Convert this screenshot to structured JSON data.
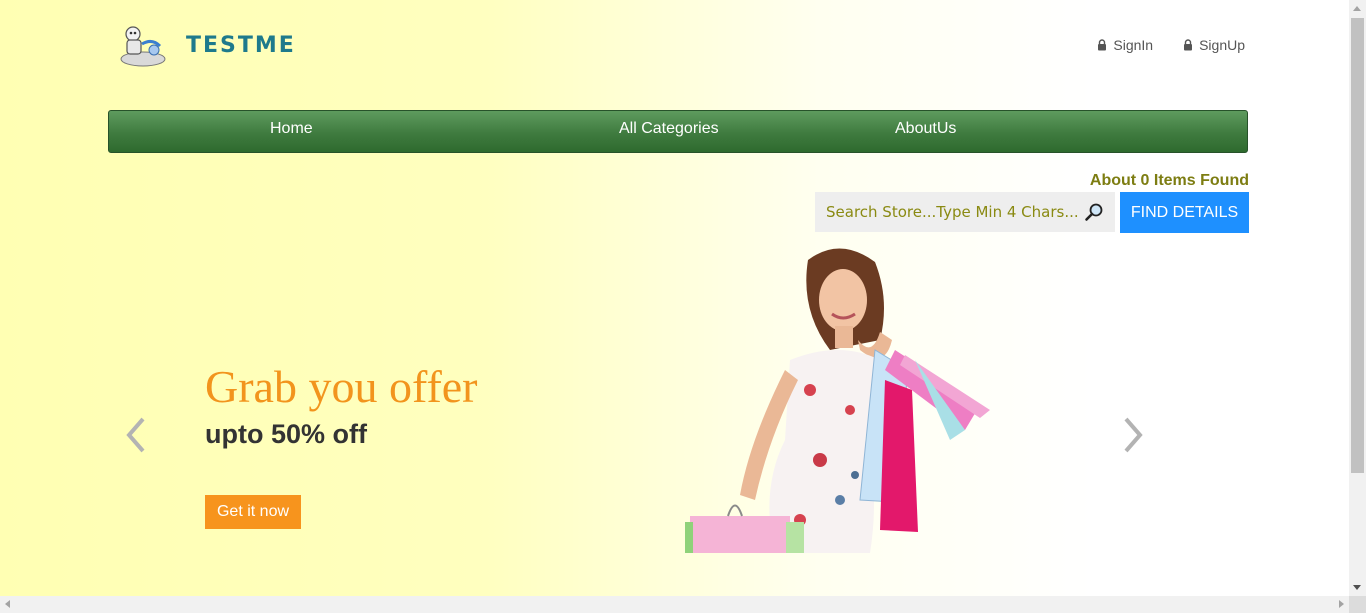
{
  "header": {
    "logo_text": "TESTME",
    "signin_label": "SignIn",
    "signup_label": "SignUp"
  },
  "nav": {
    "items": [
      {
        "label": "Home"
      },
      {
        "label": "All Categories"
      },
      {
        "label": "AboutUs"
      }
    ]
  },
  "search": {
    "result_text": "About 0 Items Found",
    "placeholder": "Search Store...Type Min 4 Chars...",
    "button_label": "FIND DETAILS"
  },
  "hero": {
    "title": "Grab you offer",
    "subtitle": "upto 50% off",
    "cta_label": "Get it now"
  },
  "colors": {
    "nav_green": "#3f7b3f",
    "find_button": "#1e90ff",
    "cta_orange": "#f7941d",
    "title_orange": "#f2941d",
    "found_text": "#7d7d12"
  },
  "icons": [
    "lock-icon",
    "magnifier-icon",
    "chevron-left-icon",
    "chevron-right-icon"
  ]
}
